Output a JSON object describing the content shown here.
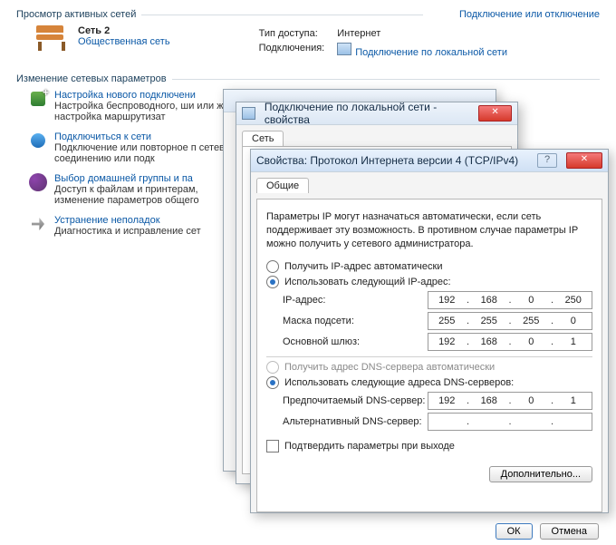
{
  "top": {
    "active_networks": "Просмотр активных сетей",
    "connect_or_disconnect": "Подключение или отключение",
    "network_name": "Сеть 2",
    "network_type": "Общественная сеть",
    "access_label": "Тип доступа:",
    "access_value": "Интернет",
    "connections_label": "Подключения:",
    "local_conn_link": "Подключение по локальной сети"
  },
  "change": {
    "header": "Изменение сетевых параметров",
    "tasks": [
      {
        "title": "Настройка нового подключени",
        "desc": "Настройка беспроводного, ши или же настройка маршрутизат"
      },
      {
        "title": "Подключиться к сети",
        "desc": "Подключение или повторное п сетевому соединению или подк"
      },
      {
        "title": "Выбор домашней группы и па",
        "desc": "Доступ к файлам и принтерам, изменение параметров общего"
      },
      {
        "title": "Устранение неполадок",
        "desc": "Диагностика и исправление сет"
      }
    ]
  },
  "dlg2": {
    "title": "Подключение по локальной сети - свойства",
    "tab": "Сеть"
  },
  "dlg3": {
    "title": "Свойства: Протокол Интернета версии 4 (TCP/IPv4)",
    "tab": "Общие",
    "help": "Параметры IP могут назначаться автоматически, если сеть поддерживает эту возможность. В противном случае параметры IP можно получить у сетевого администратора.",
    "r_auto_ip": "Получить IP-адрес автоматически",
    "r_use_ip": "Использовать следующий IP-адрес:",
    "ip_label": "IP-адрес:",
    "mask_label": "Маска подсети:",
    "gw_label": "Основной шлюз:",
    "r_auto_dns": "Получить адрес DNS-сервера автоматически",
    "r_use_dns": "Использовать следующие адреса DNS-серверов:",
    "dns1_label": "Предпочитаемый DNS-сервер:",
    "dns2_label": "Альтернативный DNS-сервер:",
    "ip": [
      "192",
      "168",
      "0",
      "250"
    ],
    "mask": [
      "255",
      "255",
      "255",
      "0"
    ],
    "gw": [
      "192",
      "168",
      "0",
      "1"
    ],
    "dns1": [
      "192",
      "168",
      "0",
      "1"
    ],
    "dns2": [
      "",
      "",
      "",
      ""
    ],
    "confirm": "Подтвердить параметры при выходе",
    "advanced": "Дополнительно...",
    "ok": "ОК",
    "cancel": "Отмена"
  }
}
